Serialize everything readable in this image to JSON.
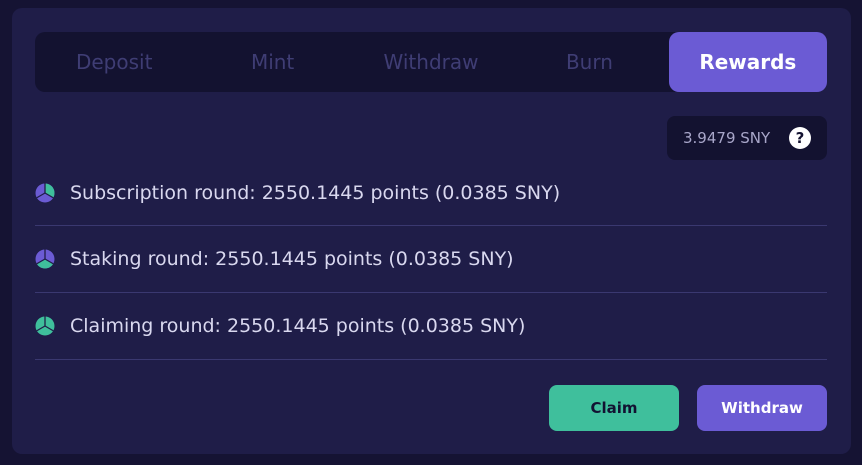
{
  "tabs": [
    {
      "label": "Deposit"
    },
    {
      "label": "Mint"
    },
    {
      "label": "Withdraw"
    },
    {
      "label": "Burn"
    },
    {
      "label": "Rewards"
    }
  ],
  "active_tab": "Rewards",
  "balance": {
    "text": "3.9479 SNY",
    "help_icon": "question-mark-icon",
    "help_glyph": "?"
  },
  "rounds": [
    {
      "text": "Subscription round: 2550.1445 points (0.0385 SNY)",
      "icon": "pie-chart-icon",
      "icon_color": "#6b5bd4"
    },
    {
      "text": "Staking round: 2550.1445 points (0.0385 SNY)",
      "icon": "pie-chart-icon",
      "icon_color": "#6b5bd4"
    },
    {
      "text": "Claiming round: 2550.1445 points (0.0385 SNY)",
      "icon": "pie-chart-icon",
      "icon_color": "#3fbf9c"
    }
  ],
  "actions": {
    "claim_label": "Claim",
    "withdraw_label": "Withdraw"
  },
  "colors": {
    "background": "#151333",
    "card": "#1f1d48",
    "accent_purple": "#6b5bd4",
    "accent_green": "#3fbf9c",
    "tab_inactive_text": "#3f3d74"
  }
}
